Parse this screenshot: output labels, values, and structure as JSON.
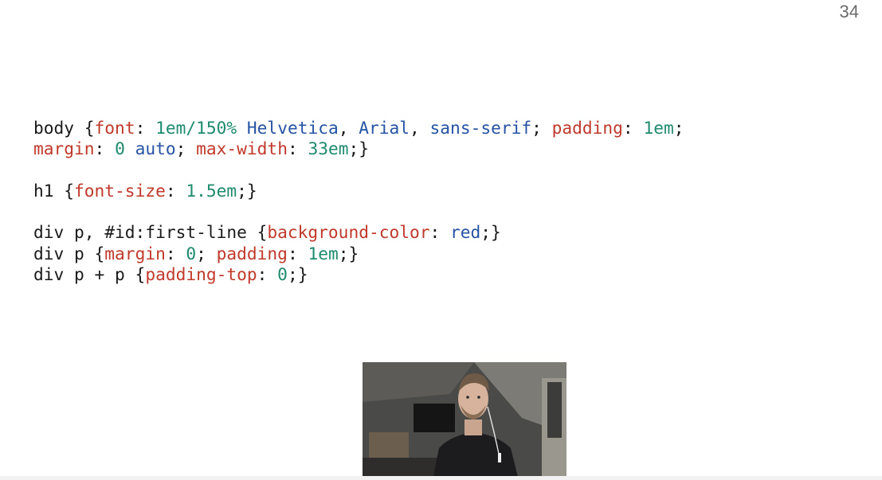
{
  "slide": {
    "page_number": "34"
  },
  "code": {
    "lines": [
      [
        {
          "t": "body {",
          "c": "default"
        },
        {
          "t": "font",
          "c": "prop"
        },
        {
          "t": ": ",
          "c": "default"
        },
        {
          "t": "1em/150%",
          "c": "num"
        },
        {
          "t": " ",
          "c": "default"
        },
        {
          "t": "Helvetica",
          "c": "kw"
        },
        {
          "t": ", ",
          "c": "default"
        },
        {
          "t": "Arial",
          "c": "kw"
        },
        {
          "t": ", ",
          "c": "default"
        },
        {
          "t": "sans-serif",
          "c": "kw"
        },
        {
          "t": "; ",
          "c": "default"
        },
        {
          "t": "padding",
          "c": "prop"
        },
        {
          "t": ": ",
          "c": "default"
        },
        {
          "t": "1em",
          "c": "num"
        },
        {
          "t": ";",
          "c": "default"
        }
      ],
      [
        {
          "t": "margin",
          "c": "prop"
        },
        {
          "t": ": ",
          "c": "default"
        },
        {
          "t": "0",
          "c": "num"
        },
        {
          "t": " ",
          "c": "default"
        },
        {
          "t": "auto",
          "c": "kw"
        },
        {
          "t": "; ",
          "c": "default"
        },
        {
          "t": "max-width",
          "c": "prop"
        },
        {
          "t": ": ",
          "c": "default"
        },
        {
          "t": "33em",
          "c": "num"
        },
        {
          "t": ";}",
          "c": "default"
        }
      ],
      [],
      [
        {
          "t": "h1 {",
          "c": "default"
        },
        {
          "t": "font-size",
          "c": "prop"
        },
        {
          "t": ": ",
          "c": "default"
        },
        {
          "t": "1.5em",
          "c": "num"
        },
        {
          "t": ";}",
          "c": "default"
        }
      ],
      [],
      [
        {
          "t": "div p, #id:first-line {",
          "c": "default"
        },
        {
          "t": "background-color",
          "c": "prop"
        },
        {
          "t": ": ",
          "c": "default"
        },
        {
          "t": "red",
          "c": "kw"
        },
        {
          "t": ";}",
          "c": "default"
        }
      ],
      [
        {
          "t": "div p {",
          "c": "default"
        },
        {
          "t": "margin",
          "c": "prop"
        },
        {
          "t": ": ",
          "c": "default"
        },
        {
          "t": "0",
          "c": "num"
        },
        {
          "t": "; ",
          "c": "default"
        },
        {
          "t": "padding",
          "c": "prop"
        },
        {
          "t": ": ",
          "c": "default"
        },
        {
          "t": "1em",
          "c": "num"
        },
        {
          "t": ";}",
          "c": "default"
        }
      ],
      [
        {
          "t": "div p + p {",
          "c": "default"
        },
        {
          "t": "padding-top",
          "c": "prop"
        },
        {
          "t": ": ",
          "c": "default"
        },
        {
          "t": "0",
          "c": "num"
        },
        {
          "t": ";}",
          "c": "default"
        }
      ]
    ]
  },
  "webcam": {
    "icon": "presenter-video-feed"
  },
  "colors": {
    "property": "#c0392b",
    "number": "#1e8a6e",
    "keyword": "#2653a3",
    "default": "#1a1a1a",
    "page_number": "#6b6b6b"
  }
}
